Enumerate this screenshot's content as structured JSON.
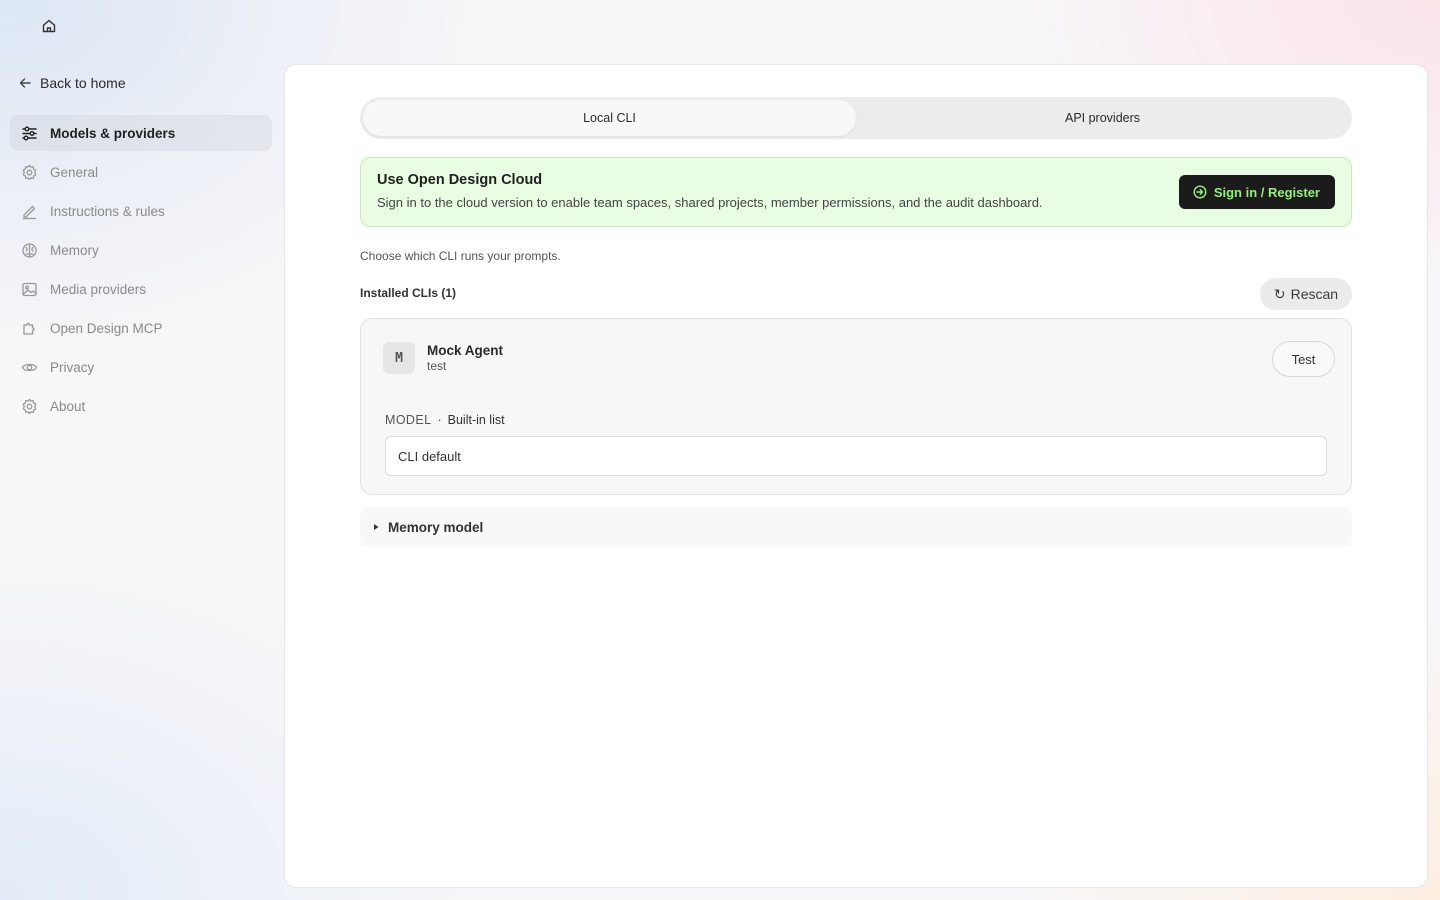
{
  "nav": {
    "home_icon": "home-icon",
    "back_label": "Back to home"
  },
  "sidebar": {
    "items": [
      {
        "label": "Models & providers",
        "icon": "sliders-icon",
        "active": true
      },
      {
        "label": "General",
        "icon": "gear-icon"
      },
      {
        "label": "Instructions & rules",
        "icon": "pen-icon"
      },
      {
        "label": "Memory",
        "icon": "brain-icon"
      },
      {
        "label": "Media providers",
        "icon": "image-icon"
      },
      {
        "label": "Open Design MCP",
        "icon": "plugin-icon"
      },
      {
        "label": "Privacy",
        "icon": "eye-icon"
      },
      {
        "label": "About",
        "icon": "gear-icon"
      }
    ]
  },
  "tabs": [
    {
      "label": "Local CLI",
      "active": true
    },
    {
      "label": "API providers"
    }
  ],
  "cloud": {
    "title": "Use Open Design Cloud",
    "description": "Sign in to the cloud version to enable team spaces, shared projects, member permissions, and the audit dashboard.",
    "button_label": "Sign in / Register",
    "accent": "#8ff56c"
  },
  "cli": {
    "intro": "Choose which CLI runs your prompts.",
    "installed_label": "Installed CLIs (1)",
    "rescan_glyph": "↻",
    "rescan_label": "Rescan",
    "agent": {
      "initial": "M",
      "name": "Mock Agent",
      "subtitle": "test",
      "test_label": "Test",
      "model_label": "MODEL",
      "model_separator": "·",
      "model_source": "Built-in list",
      "model_value": "CLI default"
    }
  },
  "memory_model": {
    "label": "Memory model"
  }
}
